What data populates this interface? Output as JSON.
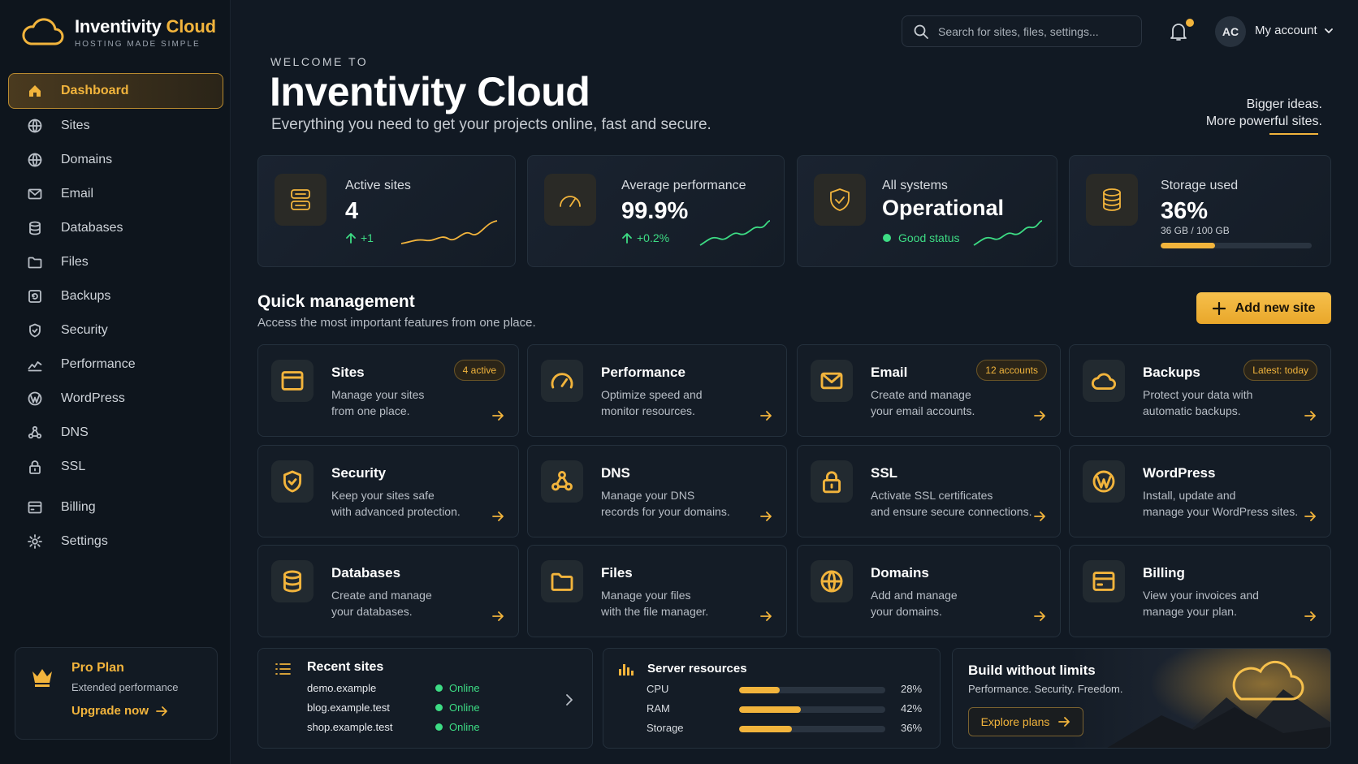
{
  "app": {
    "name_main": "Inventivity",
    "name_accent": "Cloud",
    "tagline": "HOSTING MADE SIMPLE"
  },
  "sidebar": {
    "items": [
      {
        "label": "Dashboard",
        "icon": "home-icon",
        "active": true
      },
      {
        "label": "Sites",
        "icon": "globe-icon"
      },
      {
        "label": "Domains",
        "icon": "globe-icon"
      },
      {
        "label": "Email",
        "icon": "mail-icon"
      },
      {
        "label": "Databases",
        "icon": "database-icon"
      },
      {
        "label": "Files",
        "icon": "folder-icon"
      },
      {
        "label": "Backups",
        "icon": "backup-icon"
      },
      {
        "label": "Security",
        "icon": "shield-icon"
      },
      {
        "label": "Performance",
        "icon": "chart-line-icon"
      },
      {
        "label": "WordPress",
        "icon": "wordpress-icon"
      },
      {
        "label": "DNS",
        "icon": "dns-icon"
      },
      {
        "label": "SSL",
        "icon": "lock-icon"
      },
      {
        "label": "Billing",
        "icon": "billing-icon"
      },
      {
        "label": "Settings",
        "icon": "gear-icon"
      }
    ],
    "plan": {
      "name": "Pro Plan",
      "desc": "Extended performance",
      "cta": "Upgrade now"
    }
  },
  "header": {
    "search_placeholder": "Search for sites, files, settings...",
    "avatar_initials": "AC",
    "account_label": "My account"
  },
  "hero": {
    "welcome": "WELCOME TO",
    "title": "Inventivity Cloud",
    "subtitle": "Everything you need to get your projects online, fast and secure.",
    "tagline_1": "Bigger ideas.",
    "tagline_2": "More powerful sites."
  },
  "stats": {
    "active_sites": {
      "label": "Active sites",
      "value": "4",
      "delta": "+1"
    },
    "performance": {
      "label": "Average performance",
      "value": "99.9%",
      "delta": "+0.2%"
    },
    "systems": {
      "label": "All systems",
      "value": "Operational",
      "status": "Good status"
    },
    "storage": {
      "label": "Storage used",
      "value": "36%",
      "detail": "36 GB / 100 GB",
      "fraction": 0.36
    }
  },
  "quick": {
    "title": "Quick management",
    "subtitle": "Access the most important features from one place.",
    "add_button": "Add new site",
    "tiles": [
      {
        "title": "Sites",
        "desc1": "Manage your sites",
        "desc2": "from one place.",
        "badge": "4 active",
        "icon": "browser-window-icon"
      },
      {
        "title": "Performance",
        "desc1": "Optimize speed and",
        "desc2": "monitor resources.",
        "badge": "",
        "icon": "gauge-icon"
      },
      {
        "title": "Email",
        "desc1": "Create and manage",
        "desc2": "your email accounts.",
        "badge": "12 accounts",
        "icon": "mail-icon"
      },
      {
        "title": "Backups",
        "desc1": "Protect your data with",
        "desc2": "automatic backups.",
        "badge": "Latest: today",
        "icon": "cloud-icon"
      },
      {
        "title": "Security",
        "desc1": "Keep your sites safe",
        "desc2": "with advanced protection.",
        "badge": "",
        "icon": "shield-icon"
      },
      {
        "title": "DNS",
        "desc1": "Manage your DNS",
        "desc2": "records for your domains.",
        "badge": "",
        "icon": "dns-icon"
      },
      {
        "title": "SSL",
        "desc1": "Activate SSL certificates",
        "desc2": "and ensure secure connections.",
        "badge": "",
        "icon": "lock-icon"
      },
      {
        "title": "WordPress",
        "desc1": "Install, update and",
        "desc2": "manage your WordPress sites.",
        "badge": "",
        "icon": "wordpress-icon"
      },
      {
        "title": "Databases",
        "desc1": "Create and manage",
        "desc2": "your databases.",
        "badge": "",
        "icon": "database-icon"
      },
      {
        "title": "Files",
        "desc1": "Manage your files",
        "desc2": "with the file manager.",
        "badge": "",
        "icon": "folder-icon"
      },
      {
        "title": "Domains",
        "desc1": "Add and manage",
        "desc2": "your domains.",
        "badge": "",
        "icon": "globe-icon"
      },
      {
        "title": "Billing",
        "desc1": "View your invoices and",
        "desc2": "manage your plan.",
        "badge": "",
        "icon": "billing-icon"
      }
    ]
  },
  "recent_sites": {
    "title": "Recent sites",
    "rows": [
      {
        "name": "demo.example",
        "status": "Online"
      },
      {
        "name": "blog.example.test",
        "status": "Online"
      },
      {
        "name": "shop.example.test",
        "status": "Online"
      }
    ]
  },
  "server_resources": {
    "title": "Server resources",
    "rows": [
      {
        "label": "CPU",
        "pct": "28%",
        "value": 0.28
      },
      {
        "label": "RAM",
        "pct": "42%",
        "value": 0.42
      },
      {
        "label": "Storage",
        "pct": "36%",
        "value": 0.36
      }
    ]
  },
  "promo": {
    "title": "Build without limits",
    "subtitle": "Performance. Security. Freedom.",
    "button": "Explore plans"
  },
  "colors": {
    "accent": "#f2b43c",
    "success": "#3ddc84",
    "background": "#111923"
  }
}
